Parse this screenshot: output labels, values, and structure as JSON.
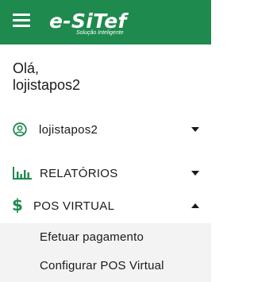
{
  "header": {
    "brand_name": "e-SiTef",
    "brand_tagline": "Solução Inteligente",
    "menu_icon": "hamburger-menu-icon"
  },
  "greeting": {
    "line1": "Olá,",
    "line2": "lojistapos2"
  },
  "menu": {
    "user": {
      "label": "lojistapos2",
      "icon": "user-circle-icon",
      "expanded": false
    },
    "reports": {
      "label": "RELATÓRIOS",
      "icon": "bar-chart-icon",
      "expanded": false
    },
    "pos_virtual": {
      "label": "POS VIRTUAL",
      "icon": "dollar-sign-icon",
      "expanded": true,
      "items": [
        {
          "label": "Efetuar pagamento"
        },
        {
          "label": "Configurar POS Virtual"
        }
      ]
    }
  },
  "colors": {
    "brand_green": "#1e8a4e",
    "submenu_bg": "#f3f3f3",
    "text": "#1a1a1a"
  }
}
